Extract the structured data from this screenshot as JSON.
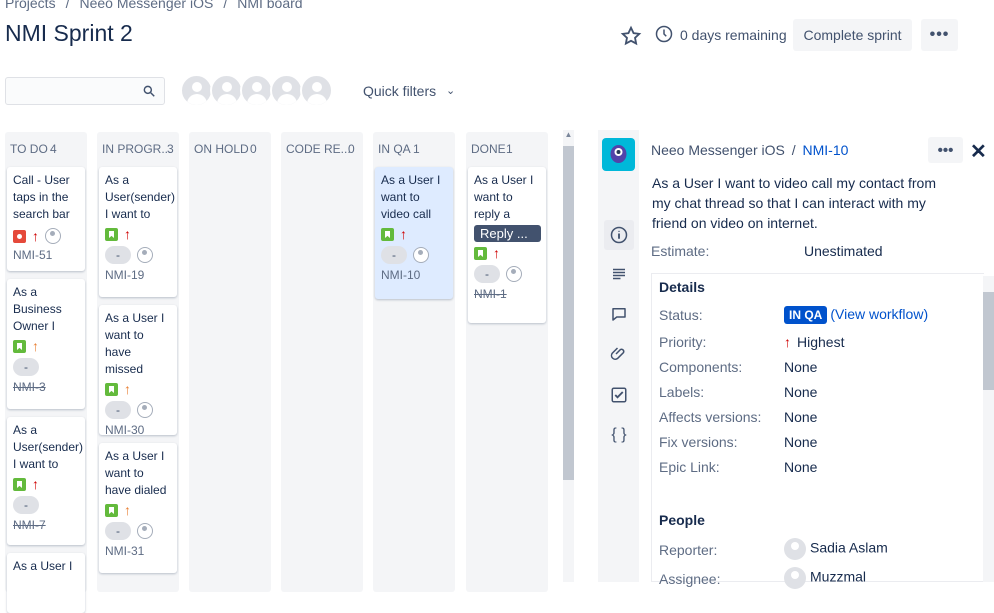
{
  "breadcrumb": [
    "Projects",
    "Neeo Messenger iOS",
    "NMI board"
  ],
  "page_title": "NMI Sprint 2",
  "header": {
    "days_remaining": "0 days remaining",
    "complete_sprint": "Complete sprint",
    "more": "•••"
  },
  "filters": {
    "quick_filters": "Quick filters"
  },
  "columns": [
    {
      "name": "TO DO",
      "count": "4"
    },
    {
      "name": "IN PROGR...",
      "count": "3"
    },
    {
      "name": "ON HOLD",
      "count": "0"
    },
    {
      "name": "CODE RE...",
      "count": "0"
    },
    {
      "name": "IN QA",
      "count": "1"
    },
    {
      "name": "DONE",
      "count": "1"
    }
  ],
  "cards": {
    "todo": [
      {
        "title": "Call - User taps in the search bar",
        "key": "NMI-51"
      },
      {
        "title": "As a Business Owner I",
        "key": "NMI-3",
        "pill": "-"
      },
      {
        "title": "As a User(sender) I want to",
        "key": "NMI-7",
        "pill": "-"
      },
      {
        "title": "As a User I"
      }
    ],
    "inprog": [
      {
        "title": "As a User(sender) I want to",
        "key": "NMI-19",
        "pill": "-"
      },
      {
        "title": "As a User I want to have missed",
        "key": "NMI-30",
        "pill": "-"
      },
      {
        "title": "As a User I want to have dialed",
        "key": "NMI-31",
        "pill": "-"
      }
    ],
    "inqa": [
      {
        "title": "As a User I want to video call",
        "key": "NMI-10",
        "pill": "-"
      }
    ],
    "done": [
      {
        "title": "As a User I want to reply a",
        "tag": "Reply ...",
        "key": "NMI-1",
        "pill": "-"
      }
    ]
  },
  "panel": {
    "project": "Neeo Messenger iOS",
    "issue_key": "NMI-10",
    "more": "•••",
    "close": "✕",
    "summary": "As a User I want to video call my contact from my chat thread so that I can interact with my friend on video on internet.",
    "estimate_label": "Estimate:",
    "estimate_value": "Unestimated",
    "details_title": "Details",
    "fields": [
      {
        "label": "Status:",
        "value": "IN QA"
      },
      {
        "label": "Priority:",
        "value": "Highest"
      },
      {
        "label": "Components:",
        "value": "None"
      },
      {
        "label": "Labels:",
        "value": "None"
      },
      {
        "label": "Affects versions:",
        "value": "None"
      },
      {
        "label": "Fix versions:",
        "value": "None"
      },
      {
        "label": "Epic Link:",
        "value": "None"
      }
    ],
    "view_workflow": "(View workflow)",
    "people_title": "People",
    "reporter_label": "Reporter:",
    "reporter": "Sadia Aslam",
    "assignee_label": "Assignee:",
    "assignee": "Muzzmal"
  },
  "colors": {
    "accent": "#0052cc",
    "story": "#63ba3c",
    "bug": "#e5493a",
    "priority_high": "#ce0000",
    "priority_med": "#e97f33"
  }
}
